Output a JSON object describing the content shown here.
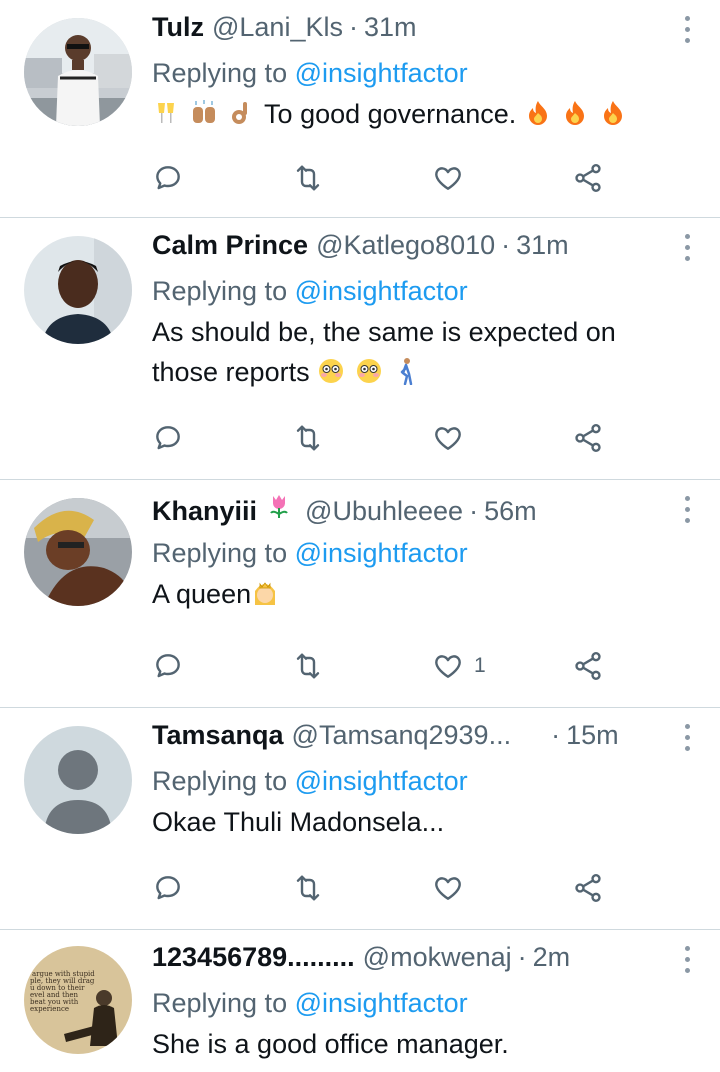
{
  "tweets": [
    {
      "name": "Tulz",
      "handle": "@Lani_Kls",
      "time": "31m",
      "reply_prefix": "Replying to",
      "reply_to": "@insightfactor",
      "text": "To good governance.",
      "likes": ""
    },
    {
      "name": "Calm Prince",
      "handle": "@Katlego8010",
      "time": "31m",
      "reply_prefix": "Replying to",
      "reply_to": "@insightfactor",
      "text_line1": "As should be, the same is expected on",
      "text_line2": "those reports",
      "likes": ""
    },
    {
      "name": "Khanyiii",
      "handle": "@Ubuhleeee",
      "time": "56m",
      "reply_prefix": "Replying to",
      "reply_to": "@insightfactor",
      "text": "A queen",
      "likes": "1"
    },
    {
      "name": "Tamsanqa",
      "handle": "@Tamsanq2939...",
      "time": "15m",
      "reply_prefix": "Replying to",
      "reply_to": "@insightfactor",
      "text": "Okae Thuli Madonsela...",
      "likes": ""
    },
    {
      "name": "123456789.........",
      "handle": "@mokwenaj",
      "time": "2m",
      "reply_prefix": "Replying to",
      "reply_to": "@insightfactor",
      "text": "She is a good office manager.",
      "likes": ""
    }
  ],
  "avatar5_quote": "argue with stupid ple, they will drag u down to their evel and then beat you with experience Mark Twain",
  "icons": [
    "reply-icon",
    "retweet-icon",
    "like-icon",
    "share-icon",
    "more-icon"
  ],
  "colors": {
    "link": "#1d9bf0",
    "muted": "#536471",
    "divider": "#cfd9de"
  }
}
